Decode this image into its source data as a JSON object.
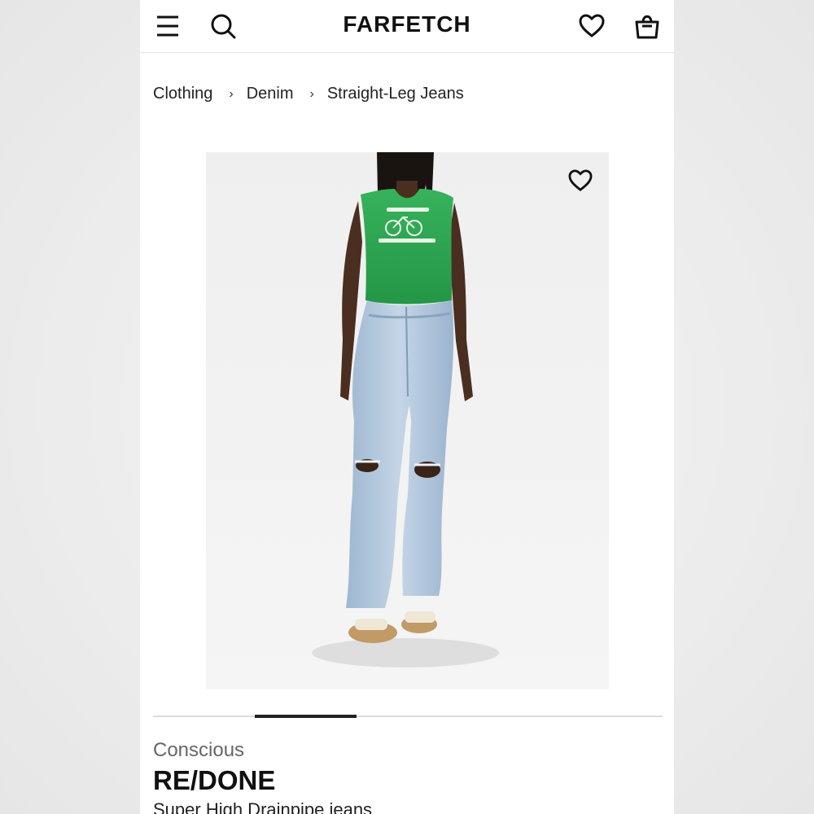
{
  "header": {
    "logo": "FARFETCH",
    "icons": [
      "menu-icon",
      "search-icon",
      "heart-icon",
      "shopping-bag-icon"
    ]
  },
  "breadcrumb": [
    "Clothing",
    "Denim",
    "Straight-Leg Jeans"
  ],
  "product": {
    "gallery": {
      "current": 2,
      "total": 5
    },
    "tag": "Conscious",
    "brand": "RE/DONE",
    "name": "Super High Drainpipe jeans"
  },
  "colors": {
    "top": "#2fa652",
    "denim": "#a9c0d8",
    "text": "#111111"
  }
}
